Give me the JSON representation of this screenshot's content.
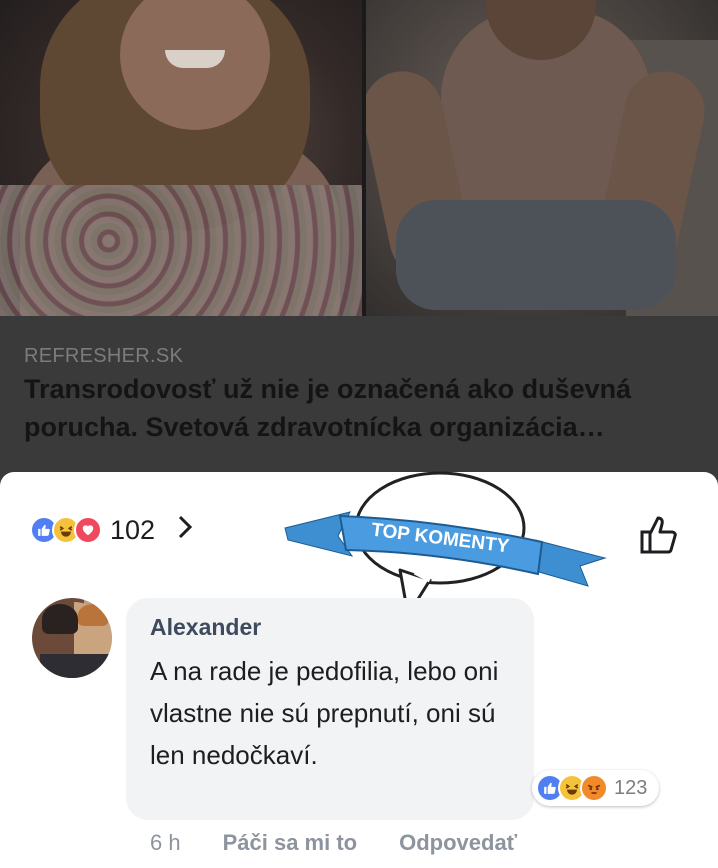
{
  "article": {
    "source": "REFRESHER.SK",
    "headline": "Transrodovosť už nie je označená ako duševná porucha. Svetová zdravotnícka organizácia…"
  },
  "reactions": {
    "icons": [
      "like-icon",
      "haha-icon",
      "love-icon"
    ],
    "count": "102",
    "chevron": "›"
  },
  "badge": {
    "label": "TOP KOMENTY",
    "ribbon_color": "#3d8fd1"
  },
  "comment": {
    "author": "Alexander",
    "text": "A na rade je pedofilia, lebo oni vlastne nie sú prepnutí, oni sú len nedočkaví.",
    "reaction_icons": [
      "like-icon",
      "haha-icon",
      "angry-icon"
    ],
    "reaction_count": "123",
    "time": "6 h",
    "like_action": "Páči sa mi to",
    "reply_action": "Odpovedať"
  },
  "colors": {
    "like_blue": "#4f7ff0",
    "author_color": "#3e4a5e",
    "meta_gray": "#8d949e"
  }
}
